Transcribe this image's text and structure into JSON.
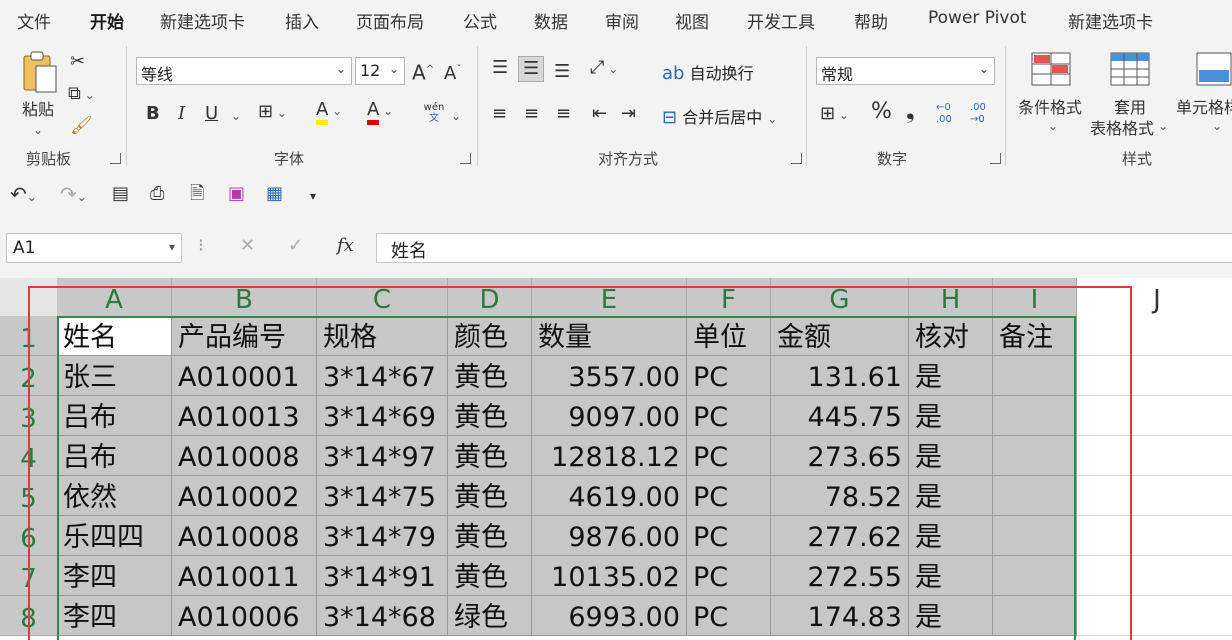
{
  "tabs": [
    "文件",
    "开始",
    "新建选项卡",
    "插入",
    "页面布局",
    "公式",
    "数据",
    "审阅",
    "视图",
    "开发工具",
    "帮助",
    "Power Pivot",
    "新建选项卡"
  ],
  "active_tab": "开始",
  "ribbon": {
    "clipboard": {
      "paste": "粘贴",
      "group": "剪贴板"
    },
    "font": {
      "name": "等线",
      "size": "12",
      "grow": "A^",
      "shrink": "Aˇ",
      "bold": "B",
      "italic": "I",
      "underline": "U",
      "phonetic_top": "wén",
      "phonetic_bottom": "文",
      "fill_glyph": "A",
      "color_glyph": "A",
      "group": "字体"
    },
    "align": {
      "wrap": "自动换行",
      "merge": "合并后居中",
      "group": "对齐方式"
    },
    "number": {
      "format": "常规",
      "percent": "%",
      "comma": "❟",
      "inc_dec_top": "←0",
      "inc_dec_bot": ".00",
      "dec_dec_top": ".00",
      "dec_dec_bot": "→0",
      "group": "数字"
    },
    "styles": {
      "conditional": "条件格式",
      "table_fmt_1": "套用",
      "table_fmt_2": "表格格式",
      "cell_style": "单元格样",
      "group": "样式"
    }
  },
  "formula": {
    "namebox": "A1",
    "fx": "fx",
    "value": "姓名"
  },
  "columns": [
    "A",
    "B",
    "C",
    "D",
    "E",
    "F",
    "G",
    "H",
    "I"
  ],
  "extra_column": "J",
  "rows": [
    "1",
    "2",
    "3",
    "4",
    "5",
    "6",
    "7",
    "8"
  ],
  "table": {
    "header": [
      "姓名",
      "产品编号",
      "规格",
      "颜色",
      "数量",
      "单位",
      "金额",
      "核对",
      "备注"
    ],
    "data": [
      [
        "张三",
        "A010001",
        "3*14*67",
        "黄色",
        "3557.00",
        "PC",
        "131.61",
        "是",
        ""
      ],
      [
        "吕布",
        "A010013",
        "3*14*69",
        "黄色",
        "9097.00",
        "PC",
        "445.75",
        "是",
        ""
      ],
      [
        "吕布",
        "A010008",
        "3*14*97",
        "黄色",
        "12818.12",
        "PC",
        "273.65",
        "是",
        ""
      ],
      [
        "依然",
        "A010002",
        "3*14*75",
        "黄色",
        "4619.00",
        "PC",
        "78.52",
        "是",
        ""
      ],
      [
        "乐四四",
        "A010008",
        "3*14*79",
        "黄色",
        "9876.00",
        "PC",
        "277.62",
        "是",
        ""
      ],
      [
        "李四",
        "A010011",
        "3*14*91",
        "黄色",
        "10135.02",
        "PC",
        "272.55",
        "是",
        ""
      ],
      [
        "李四",
        "A010006",
        "3*14*68",
        "绿色",
        "6993.00",
        "PC",
        "174.83",
        "是",
        ""
      ]
    ]
  },
  "colors": {
    "accent": "#1e7145",
    "selection_outline": "#e03a3a",
    "selected_fill": "#c7c7c7"
  }
}
